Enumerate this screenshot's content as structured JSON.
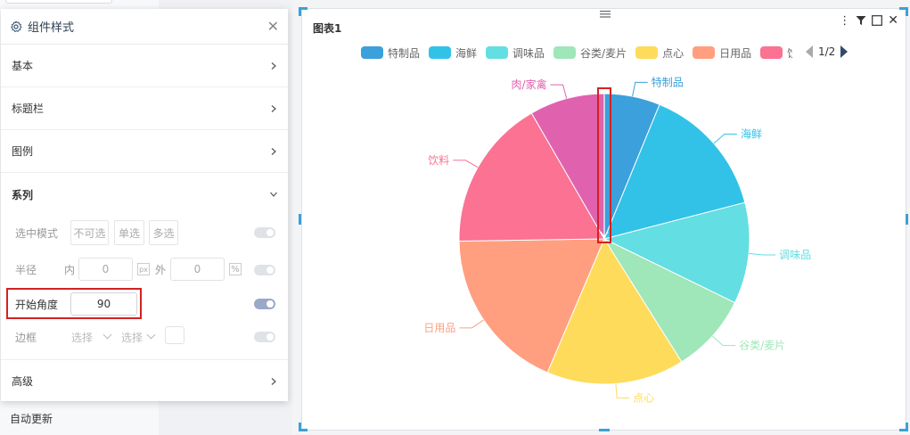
{
  "background": {
    "auto_update_label": "自动更新"
  },
  "panel": {
    "title": "组件样式",
    "sections": {
      "basic": "基本",
      "title_bar": "标题栏",
      "legend": "图例",
      "series": "系列",
      "advanced": "高级"
    },
    "select_mode": {
      "label": "选中模式",
      "options": [
        "不可选",
        "单选",
        "多选"
      ]
    },
    "radius": {
      "label": "半径",
      "inner_label": "内",
      "inner_value": "0",
      "outer_label": "外",
      "outer_value": "0",
      "unit_px": "px",
      "unit_pct": "%"
    },
    "start_angle": {
      "label": "开始角度",
      "value": "90"
    },
    "border": {
      "label": "边框",
      "select1_placeholder": "选择",
      "select2_placeholder": "选择"
    }
  },
  "card": {
    "title": "图表1",
    "pager": "1/2"
  },
  "chart_data": {
    "type": "pie",
    "start_angle": 90,
    "clockwise": true,
    "categories": [
      "特制品",
      "海鲜",
      "调味品",
      "谷类/麦片",
      "点心",
      "日用品",
      "饮料",
      "肉/家禽"
    ],
    "values": [
      6.4,
      15.2,
      11.6,
      9.1,
      15.8,
      18.9,
      17.4,
      8.6
    ],
    "colors": [
      "#3ba0dc",
      "#32c2e8",
      "#63dee2",
      "#9fe6b8",
      "#ffdb5c",
      "#ff9f7f",
      "#fb7293",
      "#e062ae"
    ],
    "legend": {
      "position": "top",
      "visible_items": [
        "特制品",
        "海鲜",
        "调味品",
        "谷类/麦片",
        "点心",
        "日用品",
        "饮料"
      ]
    }
  }
}
